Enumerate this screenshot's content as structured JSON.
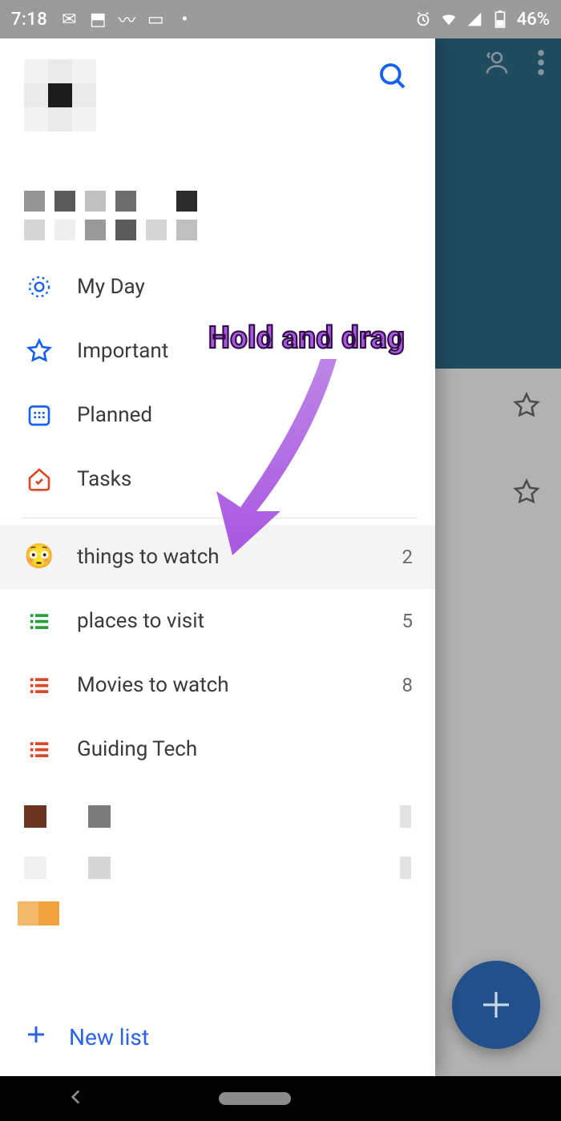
{
  "statusbar": {
    "time": "7:18",
    "battery": "46%"
  },
  "drawer": {
    "smart_lists": [
      {
        "label": "My Day",
        "icon": "sun",
        "color": "#1662f0"
      },
      {
        "label": "Important",
        "icon": "star",
        "color": "#1662f0"
      },
      {
        "label": "Planned",
        "icon": "calendar",
        "color": "#1662f0"
      },
      {
        "label": "Tasks",
        "icon": "home",
        "color": "#d9492a"
      }
    ],
    "custom_lists": [
      {
        "label": "things to watch",
        "count": 2,
        "icon": "emoji-flushed",
        "highlighted": true
      },
      {
        "label": "places to visit",
        "count": 5,
        "icon": "list-green"
      },
      {
        "label": "Movies to watch",
        "count": 8,
        "icon": "list-red"
      },
      {
        "label": "Guiding Tech",
        "count": "",
        "icon": "list-red"
      }
    ],
    "new_list_label": "New list"
  },
  "annotation": {
    "text": "Hold and drag"
  }
}
